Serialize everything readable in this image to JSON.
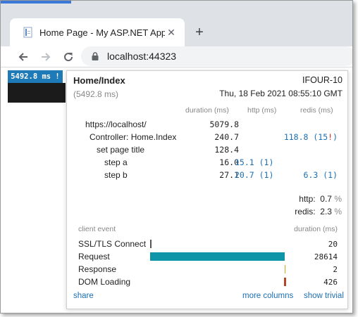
{
  "browser": {
    "tab_title": "Home Page - My ASP.NET Applic",
    "new_tab_symbol": "+",
    "url": "localhost:44323",
    "icons": [
      "favicon-icon",
      "close-icon",
      "back-icon",
      "forward-icon",
      "reload-icon",
      "lock-icon"
    ]
  },
  "miniprofiler": {
    "badge": "5492.8 ms !",
    "request_name": "Home/Index",
    "total_duration": "(5492.8 ms)",
    "machine": "IFOUR-10",
    "started": "Thu, 18 Feb 2021 08:55:10 GMT",
    "columns": {
      "duration": "duration (ms)",
      "http": "http (ms)",
      "redis": "redis (ms)"
    },
    "timings": [
      {
        "label": "https://localhost/",
        "duration": "5079.8",
        "http": "",
        "redis": "",
        "indent": 0
      },
      {
        "label": "Controller: Home.Index",
        "duration": "240.7",
        "http": "",
        "redis": "118.8 (15",
        "redis_excl": "!",
        "redis_tail": ")",
        "indent": 1
      },
      {
        "label": "set page title",
        "duration": "128.4",
        "http": "",
        "redis": "",
        "indent": 2
      },
      {
        "label": "step a",
        "duration": "16.0",
        "http": "15.1 (1)",
        "redis": "",
        "indent": 3
      },
      {
        "label": "step b",
        "duration": "27.1",
        "http": "20.7 (1)",
        "redis": "6.3 (1)",
        "indent": 3
      }
    ],
    "summary": [
      {
        "label": "http:",
        "value": "0.7",
        "unit": "%"
      },
      {
        "label": "redis:",
        "value": "2.3",
        "unit": "%"
      }
    ],
    "client_events_header": {
      "name": "client event",
      "duration": "duration (ms)"
    },
    "client_events": [
      {
        "label": "SSL/TLS Connect",
        "value": "20",
        "start_fraction": 0.0,
        "width_fraction": 0.003,
        "color": "#555555"
      },
      {
        "label": "Request",
        "value": "28614",
        "start_fraction": 0.0,
        "width_fraction": 1.0,
        "color": "#0e95a7"
      },
      {
        "label": "Response",
        "value": "2",
        "start_fraction": 0.998,
        "width_fraction": 0.003,
        "color": "#d8a21a"
      },
      {
        "label": "DOM Loading",
        "value": "426",
        "start_fraction": 0.995,
        "width_fraction": 0.015,
        "color": "#b4452a"
      }
    ],
    "footer": {
      "share": "share",
      "more_columns": "more columns",
      "show_trivial": "show trivial"
    }
  }
}
